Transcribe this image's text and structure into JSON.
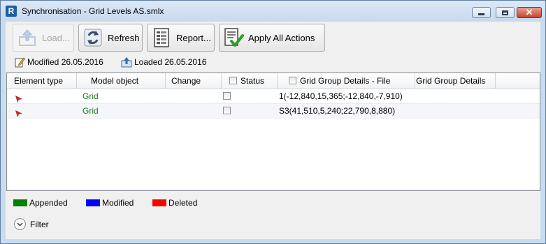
{
  "window": {
    "title": "Synchronisation - Grid Levels AS.smlx",
    "app_icon_letter": "R",
    "minimize_icon": "minimize-icon",
    "maximize_icon": "maximize-icon",
    "close_icon": "close-icon"
  },
  "toolbar": {
    "load_label": "Load...",
    "refresh_label": "Refresh",
    "report_label": "Report...",
    "apply_label": "Apply All Actions"
  },
  "info": {
    "modified": "Modified 26.05.2016",
    "loaded": "Loaded 26.05.2016"
  },
  "grid": {
    "columns": [
      "Element type",
      "Model object",
      "Change",
      "Status",
      "Grid Group Details - File",
      "Grid Group Details"
    ],
    "rows": [
      {
        "model_object": "Grid",
        "file_details": "1(-12,840,15,365;-12,840,-7,910)"
      },
      {
        "model_object": "Grid",
        "file_details": "S3(41,510,5,240;22,790,8,880)"
      }
    ]
  },
  "legend": [
    {
      "label": "Appended",
      "color": "#008000"
    },
    {
      "label": "Modified",
      "color": "#0000ff"
    },
    {
      "label": "Deleted",
      "color": "#ff0000"
    }
  ],
  "filter": {
    "label": "Filter"
  },
  "colors": {
    "model_object_text": "#1f7a1f",
    "window_frame": "#c9dbee"
  }
}
